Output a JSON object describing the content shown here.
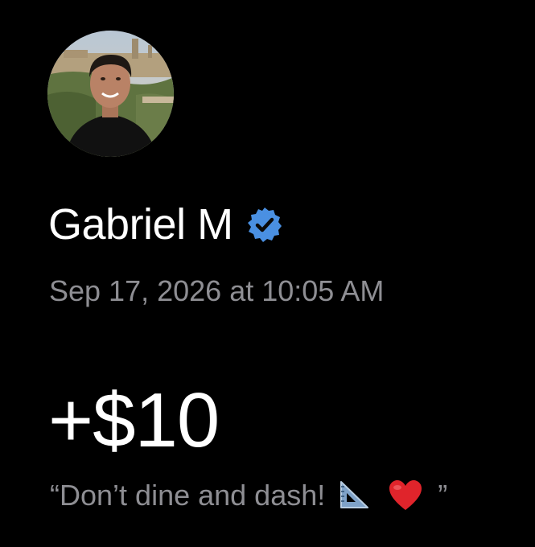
{
  "profile": {
    "name": "Gabriel M",
    "verified_icon": "verified-badge-icon",
    "avatar_icon": "profile-photo"
  },
  "transaction": {
    "timestamp": "Sep 17, 2026 at 10:05 AM",
    "amount": "+$10",
    "note_open_quote": "“",
    "note_text": "Don’t dine and dash!",
    "note_emojis": [
      "triangular-ruler-emoji",
      "red-heart-emoji"
    ],
    "note_close_quote": "”"
  },
  "colors": {
    "background": "#000000",
    "primary_text": "#ffffff",
    "secondary_text": "#8e8e93",
    "verified_blue": "#4a90e2",
    "heart_red": "#e0242b"
  }
}
